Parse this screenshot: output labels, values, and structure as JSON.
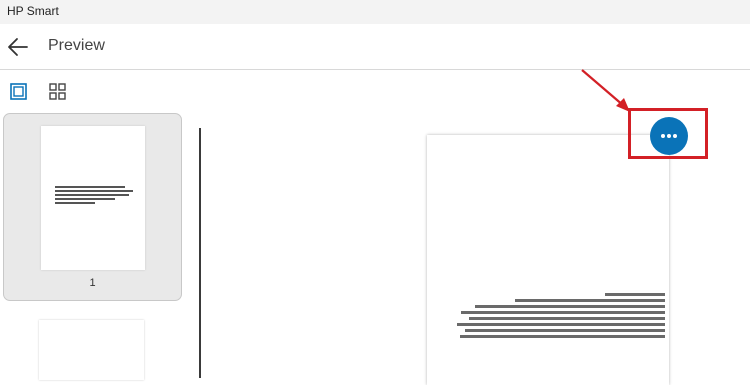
{
  "app": {
    "title": "HP Smart"
  },
  "header": {
    "title": "Preview",
    "back_icon": "back-arrow-icon"
  },
  "view_toggle": {
    "single_icon": "single-page-view-icon",
    "grid_icon": "grid-view-icon"
  },
  "thumbnails": [
    {
      "page_number": "1"
    }
  ],
  "more_button": {
    "icon": "more-options-icon"
  },
  "colors": {
    "accent": "#0a73b8",
    "highlight": "#d32026"
  }
}
